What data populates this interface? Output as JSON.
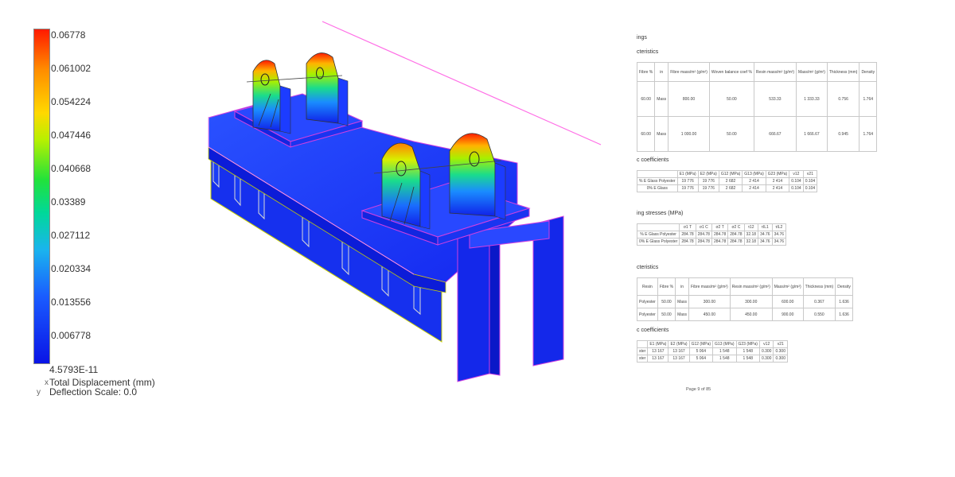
{
  "legend": {
    "values": [
      "0.06778",
      "0.061002",
      "0.054224",
      "0.047446",
      "0.040668",
      "0.03389",
      "0.027112",
      "0.020334",
      "0.013556",
      "0.006778"
    ],
    "min": "4.5793E-11",
    "title": "Total Displacement (mm)",
    "scale": "Deflection Scale: 0.0",
    "triad_x": "x",
    "triad_y": "y",
    "colors": [
      "#ff1a00",
      "#ff8c00",
      "#ffd800",
      "#22e23a",
      "#1ab4ee",
      "#0a14e6"
    ]
  },
  "doc": {
    "header": "ings",
    "sections": [
      {
        "title": "cteristics",
        "headers": [
          "Fibre %",
          "in",
          "Fibre mass/m² (g/m²)",
          "Woven balance coef %",
          "Resin mass/m² (g/m²)",
          "Mass/m² (g/m²)",
          "Thickness (mm)",
          "Density"
        ],
        "rows": [
          [
            "60.00",
            "Mass",
            "800.00",
            "50.00",
            "533.33",
            "1 333.33",
            "0.756",
            "1.764"
          ],
          [
            "60.00",
            "Mass",
            "1 000.00",
            "50.00",
            "666.67",
            "1 666.67",
            "0.945",
            "1.764"
          ]
        ]
      },
      {
        "title": "c coefficients",
        "headers": [
          "",
          "E1 (MPa)",
          "E2 (MPa)",
          "G12 (MPa)",
          "G13 (MPa)",
          "G23 (MPa)",
          "v12",
          "v21"
        ],
        "rows": [
          [
            "% E Glass Polyester",
            "19 776",
            "19 776",
            "2 682",
            "2 414",
            "2 414",
            "0.104",
            "0.104"
          ],
          [
            "0% E Glass",
            "19 776",
            "19 776",
            "2 682",
            "2 414",
            "2 414",
            "0.104",
            "0.104"
          ]
        ]
      },
      {
        "title": "ing stresses (MPa)",
        "headers": [
          "",
          "σ1 T",
          "σ1 C",
          "σ2 T",
          "σ2 C",
          "τ12",
          "τIL1",
          "τIL2"
        ],
        "rows": [
          [
            "% E Glass Polyester",
            "284.78",
            "284.78",
            "284.78",
            "284.78",
            "32.18",
            "34.76",
            "34.76"
          ],
          [
            "0% E Glass Polyester",
            "284.78",
            "284.78",
            "284.78",
            "284.78",
            "32.18",
            "34.76",
            "34.76"
          ]
        ]
      },
      {
        "title": "cteristics",
        "headers": [
          "Resin",
          "Fibre %",
          "in",
          "Fibre mass/m² (g/m²)",
          "Resin mass/m² (g/m²)",
          "Mass/m² (g/m²)",
          "Thickness (mm)",
          "Density"
        ],
        "rows": [
          [
            "Polyester",
            "50.00",
            "Mass",
            "300.00",
            "300.00",
            "600.00",
            "0.367",
            "1.636"
          ],
          [
            "Polyester",
            "50.00",
            "Mass",
            "450.00",
            "450.00",
            "900.00",
            "0.550",
            "1.636"
          ]
        ]
      },
      {
        "title": "c coefficients",
        "headers": [
          "",
          "E1 (MPa)",
          "E2 (MPa)",
          "G12 (MPa)",
          "G13 (MPa)",
          "G23 (MPa)",
          "v12",
          "v21"
        ],
        "rows": [
          [
            "ster",
            "13 167",
            "13 167",
            "5 064",
            "1 548",
            "1 548",
            "0.300",
            "0.300"
          ],
          [
            "ster",
            "13 167",
            "13 167",
            "5 064",
            "1 548",
            "1 548",
            "0.300",
            "0.300"
          ]
        ]
      }
    ],
    "page": "Page 9 of 85"
  }
}
